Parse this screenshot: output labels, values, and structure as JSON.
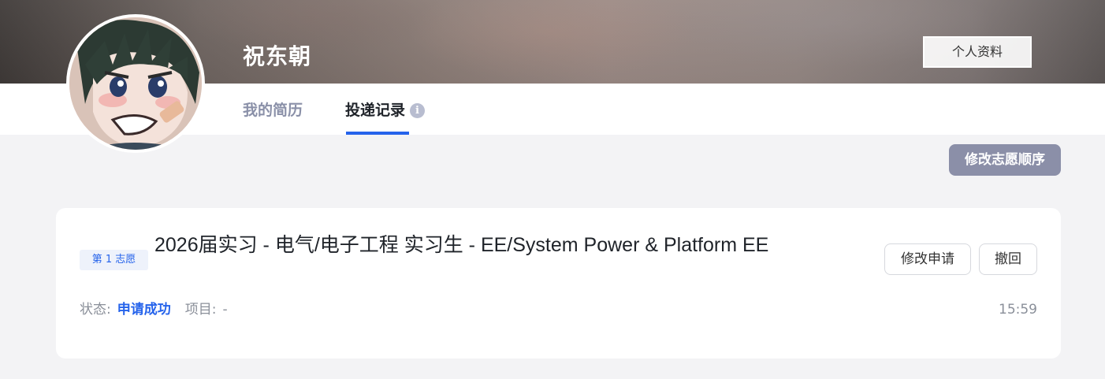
{
  "header": {
    "user_name": "祝东朝",
    "profile_button_label": "个人资料"
  },
  "tabs": [
    {
      "label": "我的简历",
      "active": false
    },
    {
      "label": "投递记录",
      "active": true,
      "info_icon": "info-icon"
    }
  ],
  "toolbar": {
    "reorder_label": "修改志愿顺序"
  },
  "applications": [
    {
      "choice_label": "第 1 志愿",
      "title": "2026届实习 - 电气/电子工程 实习生 - EE/System Power & Platform EE",
      "edit_label": "修改申请",
      "withdraw_label": "撤回",
      "status_label": "状态:",
      "status_value": "申请成功",
      "project_label": "项目:",
      "project_value": "-",
      "time": "15:59"
    }
  ],
  "colors": {
    "accent": "#2563eb",
    "reorder_bg": "#8b8fa8",
    "inactive_tab": "#8a90a8"
  }
}
